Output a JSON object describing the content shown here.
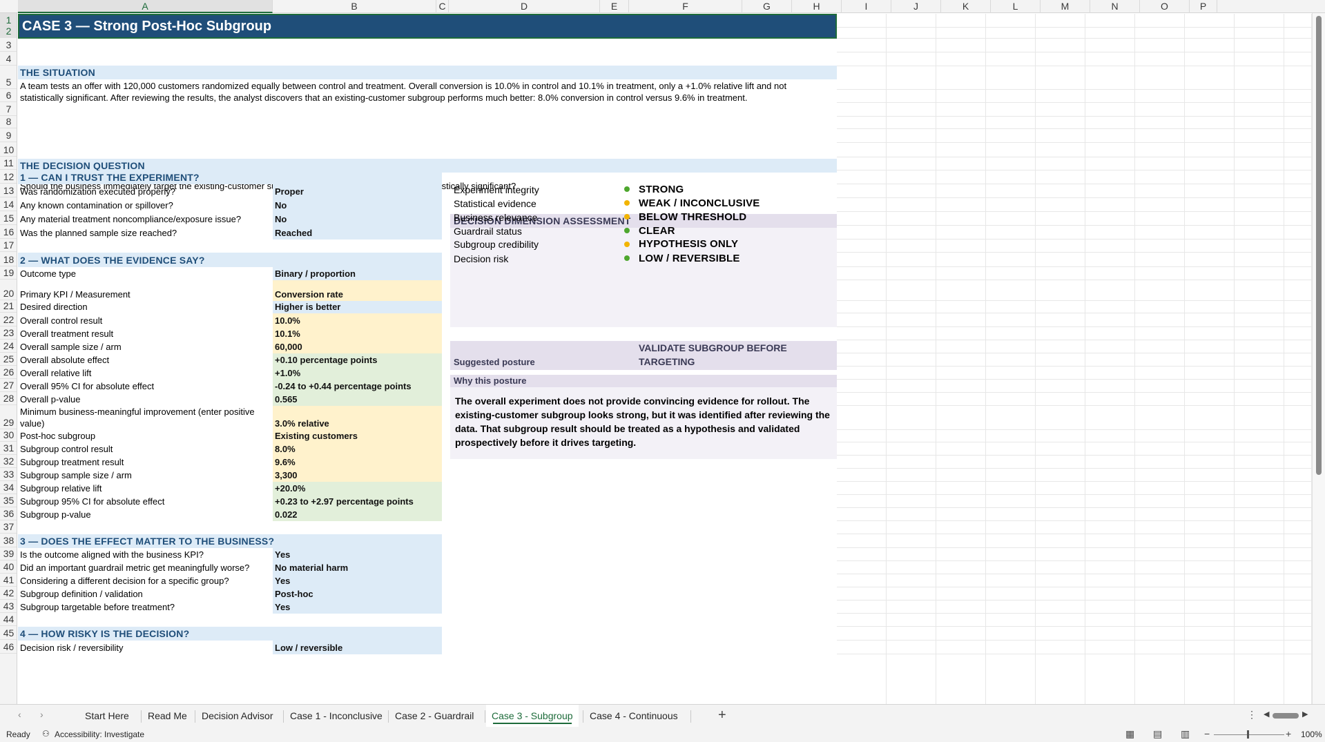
{
  "columns": [
    "A",
    "B",
    "C",
    "D",
    "E",
    "F",
    "G",
    "H",
    "I",
    "J",
    "K",
    "L",
    "M",
    "N",
    "O",
    "P"
  ],
  "title": "CASE 3 — Strong Post-Hoc Subgroup",
  "situation": {
    "heading": "THE SITUATION",
    "text": "A team tests an offer with 120,000 customers randomized equally between control and treatment. Overall conversion is 10.0% in control and 10.1% in treatment, only a +1.0% relative lift and not statistically significant. After reviewing the results, the analyst discovers that an existing-customer subgroup performs much better: 8.0% conversion in control versus 9.6% in treatment."
  },
  "question": {
    "heading": "THE DECISION QUESTION",
    "text": "Should the business immediately target the existing-customer subgroup because its post-hoc result is statistically significant?"
  },
  "section1": {
    "heading": "1 — CAN I TRUST THE EXPERIMENT?",
    "rows": [
      {
        "label": "Was randomization executed properly?",
        "value": "Proper"
      },
      {
        "label": "Any known contamination or spillover?",
        "value": "No"
      },
      {
        "label": "Any material treatment noncompliance/exposure issue?",
        "value": "No"
      },
      {
        "label": "Was the planned sample size reached?",
        "value": "Reached"
      }
    ]
  },
  "section2": {
    "heading": "2 — WHAT DOES THE EVIDENCE SAY?",
    "rows": [
      {
        "label": "Outcome type",
        "value": "Binary / proportion"
      },
      {
        "label": "Primary KPI / Measurement",
        "value": "Conversion rate"
      },
      {
        "label": "Desired direction",
        "value": "Higher is better"
      },
      {
        "label": "Overall control result",
        "value": "10.0%"
      },
      {
        "label": "Overall treatment result",
        "value": "10.1%"
      },
      {
        "label": "Overall sample size / arm",
        "value": "60,000"
      },
      {
        "label": "Overall absolute effect",
        "value": "+0.10 percentage points"
      },
      {
        "label": "Overall relative lift",
        "value": "+1.0%"
      },
      {
        "label": "Overall 95% CI for absolute effect",
        "value": "-0.24 to +0.44 percentage points"
      },
      {
        "label": "Overall p-value",
        "value": "0.565"
      },
      {
        "label": "Minimum business-meaningful improvement (enter positive",
        "label2": "value)",
        "value": "3.0% relative"
      },
      {
        "label": "Post-hoc subgroup",
        "value": "Existing customers"
      },
      {
        "label": "Subgroup control result",
        "value": "8.0%"
      },
      {
        "label": "Subgroup treatment result",
        "value": "9.6%"
      },
      {
        "label": "Subgroup sample size / arm",
        "value": "3,300"
      },
      {
        "label": "Subgroup relative lift",
        "value": "+20.0%"
      },
      {
        "label": "Subgroup 95% CI for absolute effect",
        "value": "+0.23 to +2.97 percentage points"
      },
      {
        "label": "Subgroup p-value",
        "value": "0.022"
      }
    ]
  },
  "section3": {
    "heading": "3 — DOES THE EFFECT MATTER TO THE BUSINESS?",
    "rows": [
      {
        "label": "Is the outcome aligned with the business KPI?",
        "value": "Yes"
      },
      {
        "label": "Did an important guardrail metric get meaningfully worse?",
        "value": "No material harm"
      },
      {
        "label": "Considering a different decision for a specific group?",
        "value": "Yes"
      },
      {
        "label": "Subgroup definition / validation",
        "value": "Post-hoc"
      },
      {
        "label": "Subgroup targetable before treatment?",
        "value": "Yes"
      }
    ]
  },
  "section4": {
    "heading": "4 — HOW RISKY IS THE DECISION?",
    "rows": [
      {
        "label": "Decision risk / reversibility",
        "value": "Low / reversible"
      }
    ]
  },
  "assessment": {
    "heading": "DECISION DIMENSION ASSESSMENT",
    "rows": [
      {
        "label": "Experiment integrity",
        "value": "STRONG",
        "color": "#4ea72e"
      },
      {
        "label": "Statistical evidence",
        "value": "WEAK / INCONCLUSIVE",
        "color": "#f2b400"
      },
      {
        "label": "Business relevance",
        "value": "BELOW THRESHOLD",
        "color": "#f2b400"
      },
      {
        "label": "Guardrail status",
        "value": "CLEAR",
        "color": "#4ea72e"
      },
      {
        "label": "Subgroup credibility",
        "value": "HYPOTHESIS ONLY",
        "color": "#f2b400"
      },
      {
        "label": "Decision risk",
        "value": "LOW / REVERSIBLE",
        "color": "#4ea72e"
      }
    ],
    "posture_label": "Suggested posture",
    "posture_value_line1": "VALIDATE SUBGROUP BEFORE",
    "posture_value_line2": "TARGETING",
    "why_heading": "Why this posture",
    "why_text": "The overall experiment does not provide convincing evidence for rollout. The existing-customer subgroup looks strong, but it was identified after reviewing the data. That subgroup result should be treated as a hypothesis and validated prospectively before it drives targeting."
  },
  "tabs": [
    "Start Here",
    "Read Me",
    "Decision Advisor",
    "Case 1 - Inconclusive",
    "Case 2 - Guardrail",
    "Case 3 - Subgroup",
    "Case 4 - Continuous"
  ],
  "status": {
    "ready": "Ready",
    "accessibility": "Accessibility: Investigate",
    "zoom": "100%"
  },
  "colors": {
    "title_bg": "#1f4e79",
    "section_band": "#ddebf7",
    "input_yellow": "#fff2cc",
    "calc_green": "#e2efda",
    "assess_band": "#e4dfec",
    "accent_green": "#1d6b3a"
  }
}
